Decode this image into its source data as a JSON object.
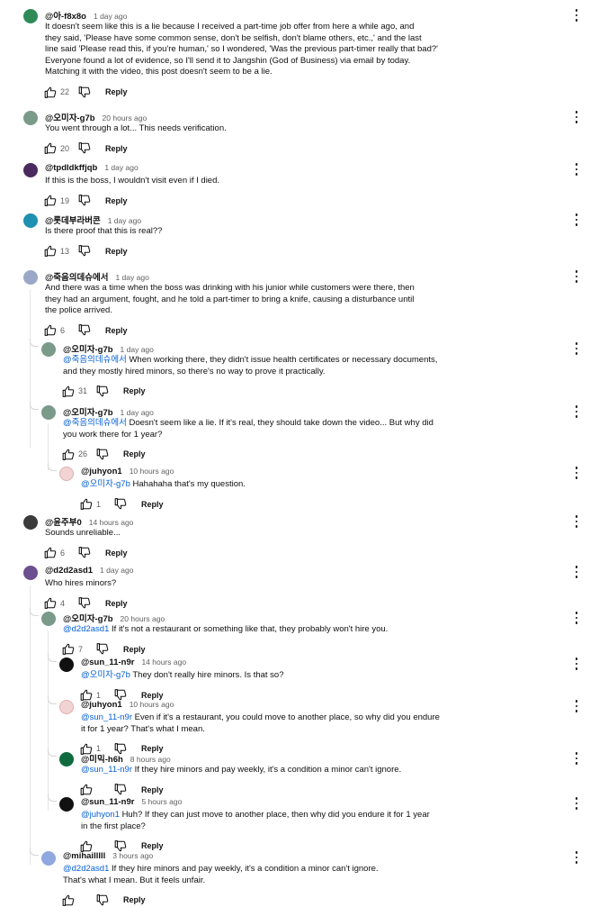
{
  "reply_label": "Reply",
  "colors": {
    "mention": "#065fd4",
    "meta": "#606060"
  },
  "comments": [
    {
      "user": "@아-f8x8o",
      "time": "1 day ago",
      "lines": [
        "It doesn't seem like this is a lie because I received a part-time job offer from here a while ago, and",
        "they said, 'Please have some common sense, don't be selfish, don't blame others, etc.,' and the last",
        "line said 'Please read this, if you're human,' so I wondered, 'Was the previous part-timer really that bad?'",
        "Everyone found a lot of evidence, so I'll send it to Jangshin (God of Business) via email by today.",
        "Matching it with the video, this post doesn't seem to be a lie."
      ],
      "likes": "22"
    },
    {
      "user": "@오미자-g7b",
      "time": "20 hours ago",
      "lines": [
        "You went through a lot... This needs verification."
      ],
      "likes": "20"
    },
    {
      "user": "@tpdldkffjqb",
      "time": "1 day ago",
      "lines": [
        "If this is the boss, I wouldn't visit even if I died."
      ],
      "likes": "19"
    },
    {
      "user": "@롯데부라버콘",
      "time": "1 day ago",
      "lines": [
        "Is there proof that this is real??"
      ],
      "likes": "13"
    },
    {
      "user": "@죽음의데슈에서",
      "time": "1 day ago",
      "lines": [
        "And there was a time when the boss was drinking with his junior while customers were there, then",
        "they had an argument, fought, and he told a part-timer to bring a knife, causing a disturbance until",
        "the police arrived."
      ],
      "likes": "6"
    },
    {
      "user": "@오미자-g7b",
      "time": "1 day ago",
      "mention": "@죽음의데슈에서",
      "lines": [
        "When working there, they didn't issue health certificates or necessary documents,",
        "and they mostly hired minors, so there's no way to prove it practically."
      ],
      "likes": "31"
    },
    {
      "user": "@오미자-g7b",
      "time": "1 day ago",
      "mention": "@죽음의데슈에서",
      "lines": [
        "Doesn't seem like a lie. If it's real, they should take down the video... But why did",
        "you work there for 1 year?"
      ],
      "likes": "26"
    },
    {
      "user": "@juhyon1",
      "time": "10 hours ago",
      "mention": "@오미자-g7b",
      "lines": [
        "Hahahaha that's my question."
      ],
      "likes": "1"
    },
    {
      "user": "@윤주부0",
      "time": "14 hours ago",
      "lines": [
        "Sounds unreliable..."
      ],
      "likes": "6"
    },
    {
      "user": "@d2d2asd1",
      "time": "1 day ago",
      "lines": [
        "Who hires minors?"
      ],
      "likes": "4"
    },
    {
      "user": "@오미자-g7b",
      "time": "20 hours ago",
      "mention": "@d2d2asd1",
      "lines": [
        "If it's not a restaurant or something like that, they probably won't hire you."
      ],
      "likes": "7"
    },
    {
      "user": "@sun_11-n9r",
      "time": "14 hours ago",
      "mention": "@오미자-g7b",
      "lines": [
        "They don't really hire minors. Is that so?"
      ],
      "likes": "1"
    },
    {
      "user": "@juhyon1",
      "time": "10 hours ago",
      "mention": "@sun_11-n9r",
      "lines": [
        "Even if it's a restaurant, you could move to another place, so why did you endure",
        "it for 1 year? That's what I mean."
      ],
      "likes": "1"
    },
    {
      "user": "@미믹-h6h",
      "time": "8 hours ago",
      "mention": "@sun_11-n9r",
      "lines": [
        "If they hire minors and pay weekly, it's a condition a minor can't ignore."
      ],
      "likes": ""
    },
    {
      "user": "@sun_11-n9r",
      "time": "5 hours ago",
      "mention": "@juhyon1",
      "lines": [
        "Huh? If they can just move to another place, then why did you endure it for 1 year",
        "in the first place?"
      ],
      "likes": ""
    },
    {
      "user": "@mihailllll",
      "time": "3 hours ago",
      "mention": "@d2d2asd1",
      "lines": [
        "If they hire minors and pay weekly, it's a condition a minor can't ignore.",
        "That's what I mean. But it feels unfair."
      ],
      "likes": ""
    }
  ]
}
